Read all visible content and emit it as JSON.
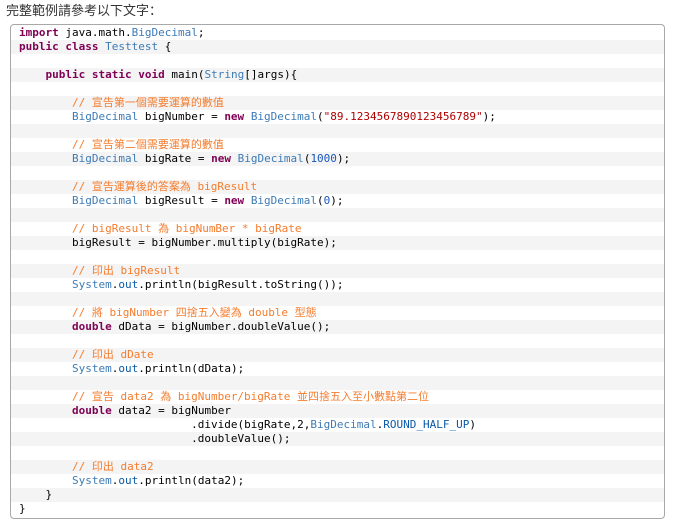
{
  "intro_text": "完整範例請參考以下文字：",
  "code_lines": [
    [
      [
        "kw",
        "import"
      ],
      [
        "pl",
        " java.math."
      ],
      [
        "ty",
        "BigDecimal"
      ],
      [
        "pl",
        ";"
      ]
    ],
    [
      [
        "kw",
        "public"
      ],
      [
        "pl",
        " "
      ],
      [
        "kw",
        "class"
      ],
      [
        "pl",
        " "
      ],
      [
        "ty",
        "Testtest"
      ],
      [
        "pl",
        " {"
      ]
    ],
    [
      [
        "pl",
        ""
      ]
    ],
    [
      [
        "pl",
        "    "
      ],
      [
        "kw",
        "public"
      ],
      [
        "pl",
        " "
      ],
      [
        "kw",
        "static"
      ],
      [
        "pl",
        " "
      ],
      [
        "kw",
        "void"
      ],
      [
        "pl",
        " main("
      ],
      [
        "ty",
        "String"
      ],
      [
        "pl",
        "[]args){"
      ]
    ],
    [
      [
        "pl",
        ""
      ]
    ],
    [
      [
        "pl",
        "        "
      ],
      [
        "cm",
        "// 宣告第一個需要運算的數值"
      ]
    ],
    [
      [
        "pl",
        "        "
      ],
      [
        "ty",
        "BigDecimal"
      ],
      [
        "pl",
        " bigNumber = "
      ],
      [
        "kw",
        "new"
      ],
      [
        "pl",
        " "
      ],
      [
        "ty",
        "BigDecimal"
      ],
      [
        "pl",
        "("
      ],
      [
        "st",
        "\"89.1234567890123456789\""
      ],
      [
        "pl",
        ");"
      ]
    ],
    [
      [
        "pl",
        ""
      ]
    ],
    [
      [
        "pl",
        "        "
      ],
      [
        "cm",
        "// 宣告第二個需要運算的數值"
      ]
    ],
    [
      [
        "pl",
        "        "
      ],
      [
        "ty",
        "BigDecimal"
      ],
      [
        "pl",
        " bigRate = "
      ],
      [
        "kw",
        "new"
      ],
      [
        "pl",
        " "
      ],
      [
        "ty",
        "BigDecimal"
      ],
      [
        "pl",
        "("
      ],
      [
        "nu",
        "1000"
      ],
      [
        "pl",
        ");"
      ]
    ],
    [
      [
        "pl",
        ""
      ]
    ],
    [
      [
        "pl",
        "        "
      ],
      [
        "cm",
        "// 宣告運算後的答案為 bigResult"
      ]
    ],
    [
      [
        "pl",
        "        "
      ],
      [
        "ty",
        "BigDecimal"
      ],
      [
        "pl",
        " bigResult = "
      ],
      [
        "kw",
        "new"
      ],
      [
        "pl",
        " "
      ],
      [
        "ty",
        "BigDecimal"
      ],
      [
        "pl",
        "("
      ],
      [
        "nu",
        "0"
      ],
      [
        "pl",
        ");"
      ]
    ],
    [
      [
        "pl",
        ""
      ]
    ],
    [
      [
        "pl",
        "        "
      ],
      [
        "cm",
        "// bigResult 為 bigNumBer * bigRate"
      ]
    ],
    [
      [
        "pl",
        "        bigResult = bigNumber.multiply(bigRate);"
      ]
    ],
    [
      [
        "pl",
        ""
      ]
    ],
    [
      [
        "pl",
        "        "
      ],
      [
        "cm",
        "// 印出 bigResult"
      ]
    ],
    [
      [
        "pl",
        "        "
      ],
      [
        "ty",
        "System"
      ],
      [
        "pl",
        "."
      ],
      [
        "fd",
        "out"
      ],
      [
        "pl",
        ".println(bigResult.toString());"
      ]
    ],
    [
      [
        "pl",
        ""
      ]
    ],
    [
      [
        "pl",
        "        "
      ],
      [
        "cm",
        "// 將 bigNumber 四捨五入變為 double 型態"
      ]
    ],
    [
      [
        "pl",
        "        "
      ],
      [
        "kw",
        "double"
      ],
      [
        "pl",
        " dData = bigNumber.doubleValue();"
      ]
    ],
    [
      [
        "pl",
        ""
      ]
    ],
    [
      [
        "pl",
        "        "
      ],
      [
        "cm",
        "// 印出 dDate"
      ]
    ],
    [
      [
        "pl",
        "        "
      ],
      [
        "ty",
        "System"
      ],
      [
        "pl",
        "."
      ],
      [
        "fd",
        "out"
      ],
      [
        "pl",
        ".println(dData);"
      ]
    ],
    [
      [
        "pl",
        ""
      ]
    ],
    [
      [
        "pl",
        "        "
      ],
      [
        "cm",
        "// 宣告 data2 為 bigNumber/bigRate 並四捨五入至小數點第二位"
      ]
    ],
    [
      [
        "pl",
        "        "
      ],
      [
        "kw",
        "double"
      ],
      [
        "pl",
        " data2 = bigNumber"
      ]
    ],
    [
      [
        "pl",
        "                          .divide(bigRate,2,"
      ],
      [
        "ty",
        "BigDecimal"
      ],
      [
        "pl",
        "."
      ],
      [
        "fd",
        "ROUND_HALF_UP"
      ],
      [
        "pl",
        ")"
      ]
    ],
    [
      [
        "pl",
        "                          .doubleValue();"
      ]
    ],
    [
      [
        "pl",
        ""
      ]
    ],
    [
      [
        "pl",
        "        "
      ],
      [
        "cm",
        "// 印出 data2"
      ]
    ],
    [
      [
        "pl",
        "        "
      ],
      [
        "ty",
        "System"
      ],
      [
        "pl",
        "."
      ],
      [
        "fd",
        "out"
      ],
      [
        "pl",
        ".println(data2);"
      ]
    ],
    [
      [
        "pl",
        "    }"
      ]
    ],
    [
      [
        "pl",
        "}"
      ]
    ]
  ]
}
